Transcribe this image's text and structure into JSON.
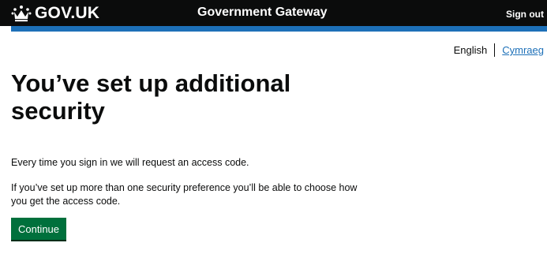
{
  "header": {
    "logo_text": "GOV.UK",
    "service_name": "Government Gateway",
    "signout_label": "Sign out"
  },
  "language": {
    "current": "English",
    "alternate": "Cymraeg"
  },
  "main": {
    "heading": "You’ve set up additional security",
    "paragraph1": "Every time you sign in we will request an access code.",
    "paragraph2": "If you’ve set up more than one security preference you’ll be able to choose how you get the access code.",
    "continue_label": "Continue"
  },
  "colors": {
    "header_bg": "#0b0c0c",
    "accent_bar": "#1d70b8",
    "link": "#1d70b8",
    "button": "#00703c"
  },
  "icons": {
    "logo": "crown-icon"
  }
}
